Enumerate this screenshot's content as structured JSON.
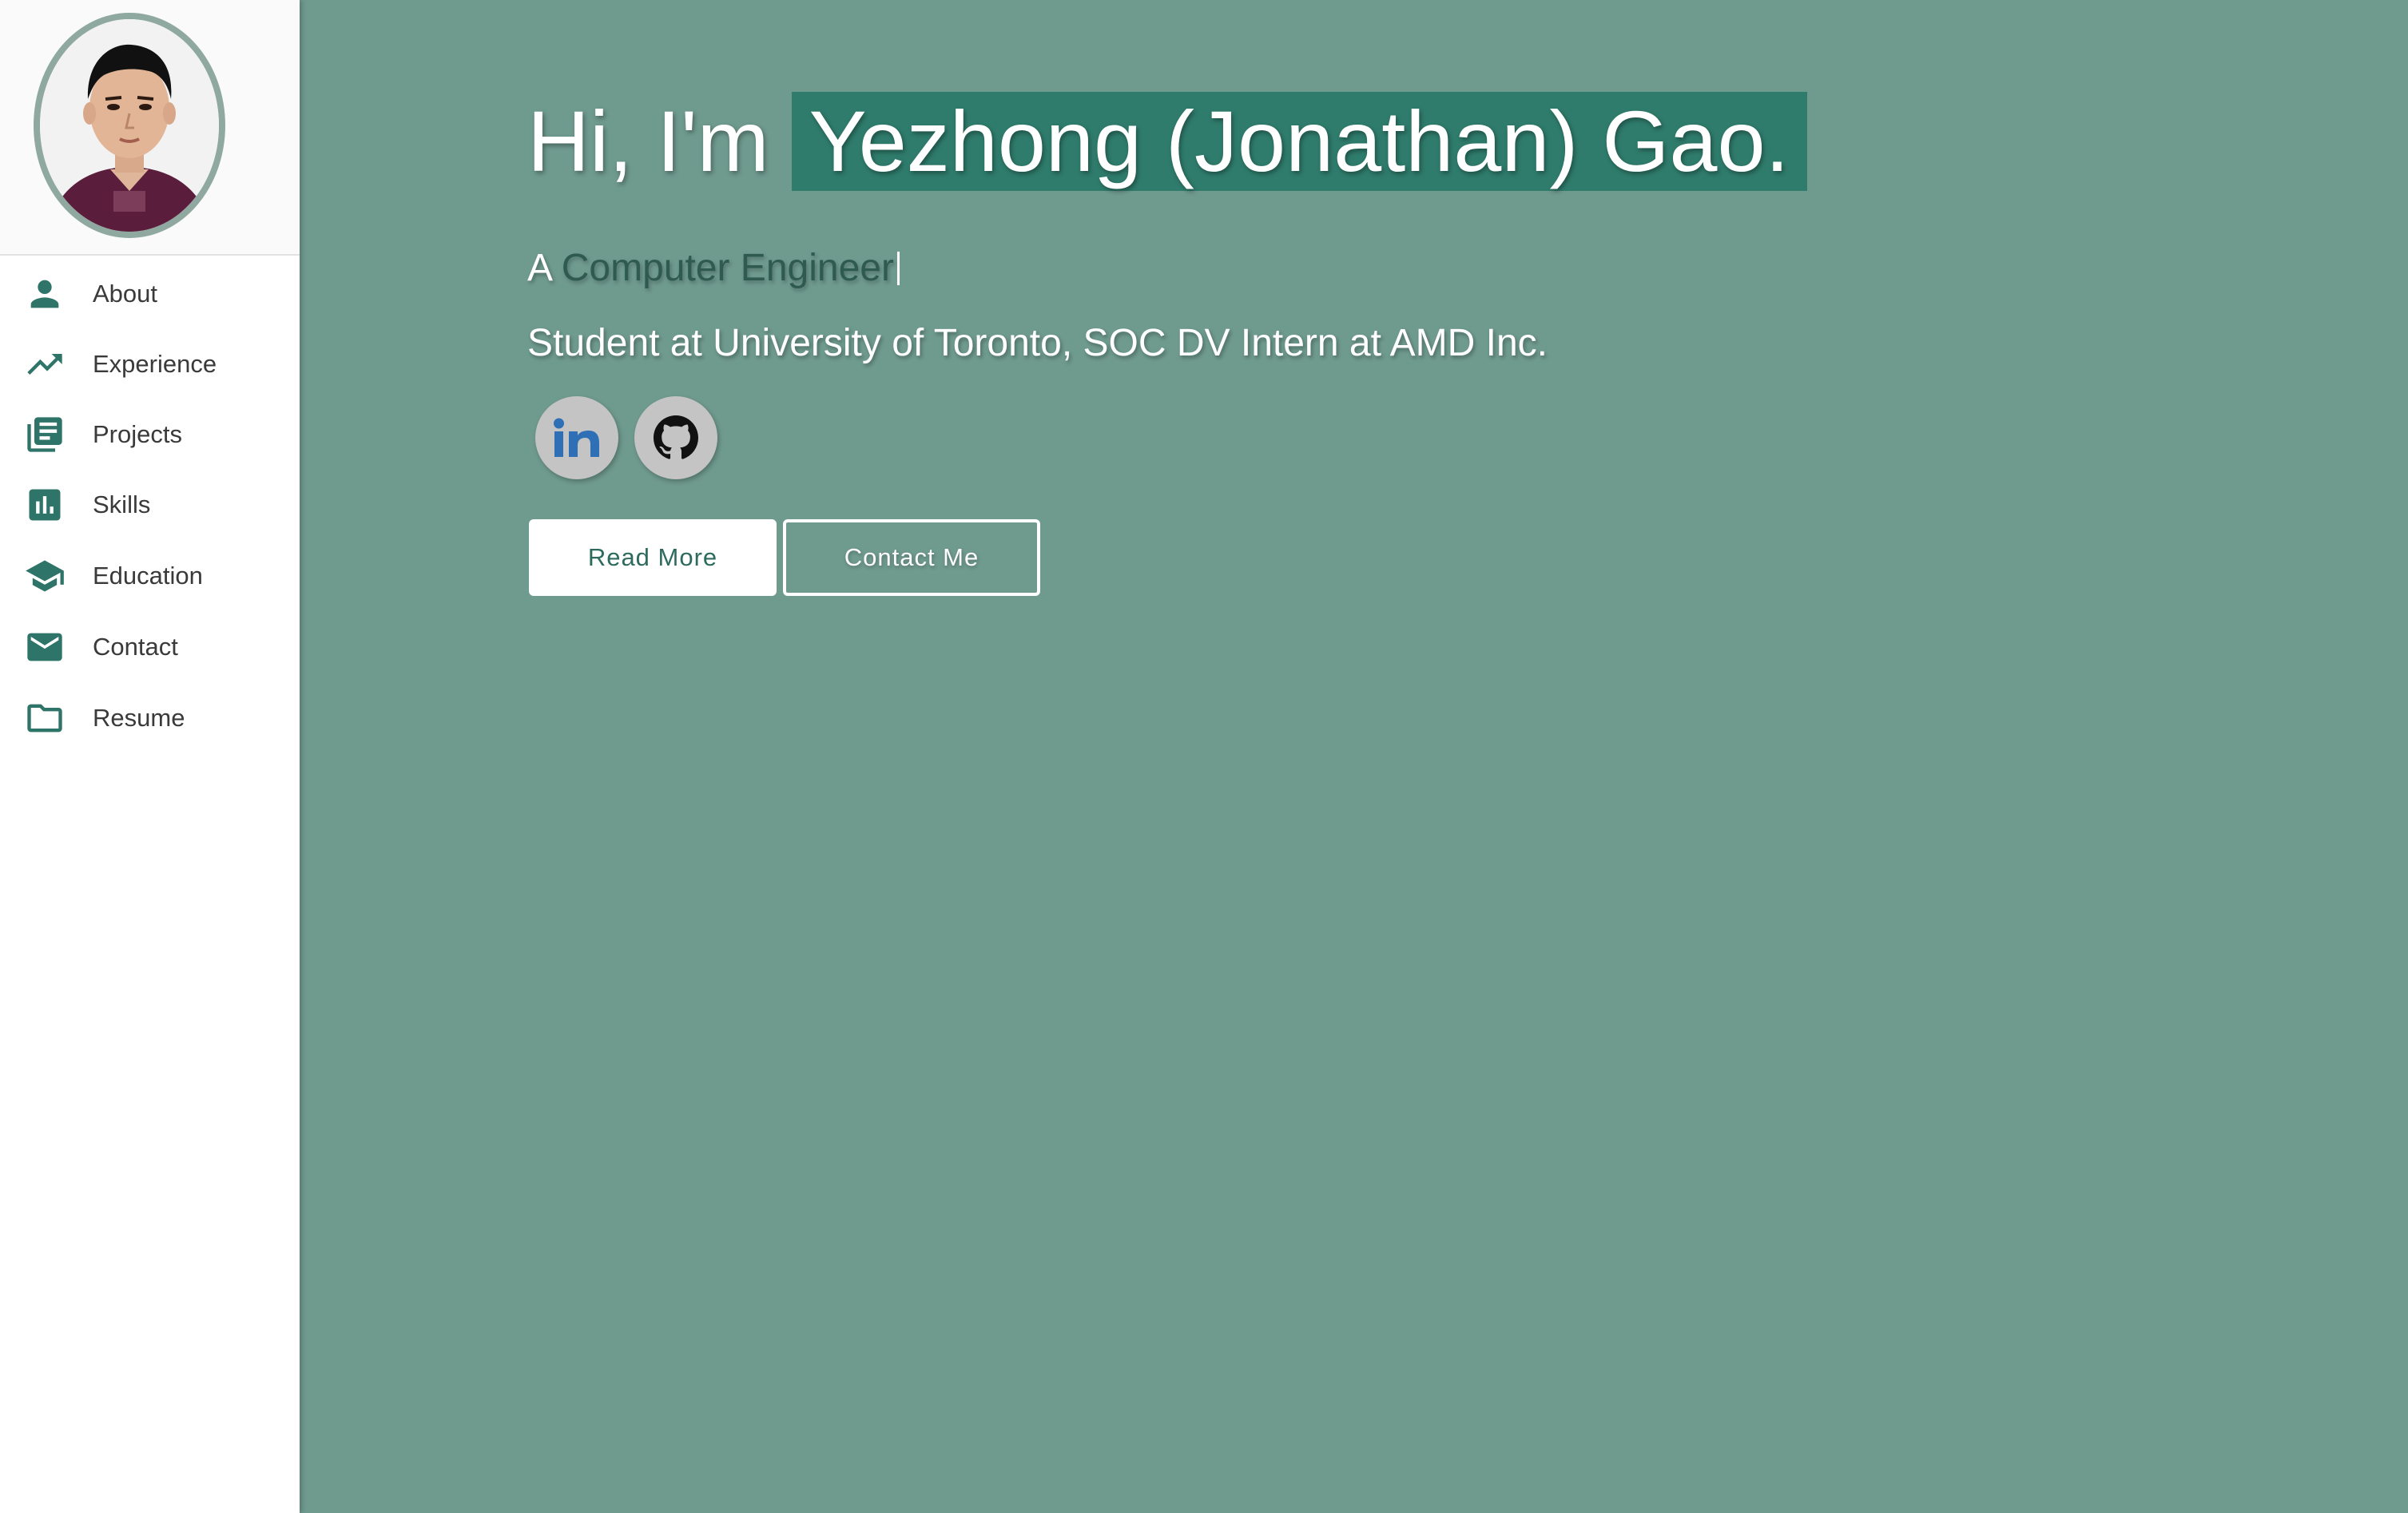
{
  "sidebar": {
    "items": [
      {
        "label": "About",
        "icon": "person-icon"
      },
      {
        "label": "Experience",
        "icon": "trending-up-icon"
      },
      {
        "label": "Projects",
        "icon": "library-books-icon"
      },
      {
        "label": "Skills",
        "icon": "bar-chart-icon"
      },
      {
        "label": "Education",
        "icon": "graduation-cap-icon"
      },
      {
        "label": "Contact",
        "icon": "mail-icon"
      },
      {
        "label": "Resume",
        "icon": "folder-icon"
      }
    ]
  },
  "hero": {
    "greeting": "Hi, I'm",
    "name": "Yezhong (Jonathan) Gao.",
    "role_prefix": "A",
    "role_typed": "Computer Engineer",
    "subtitle": "Student at University of Toronto, SOC DV Intern at AMD Inc.",
    "social": [
      {
        "icon": "linkedin-icon"
      },
      {
        "icon": "github-icon"
      }
    ],
    "buttons": {
      "read_more": "Read More",
      "contact_me": "Contact Me"
    }
  },
  "colors": {
    "accent": "#2f7c6c",
    "background": "#6f9a8e",
    "sidebar_icon": "#2f7468"
  }
}
